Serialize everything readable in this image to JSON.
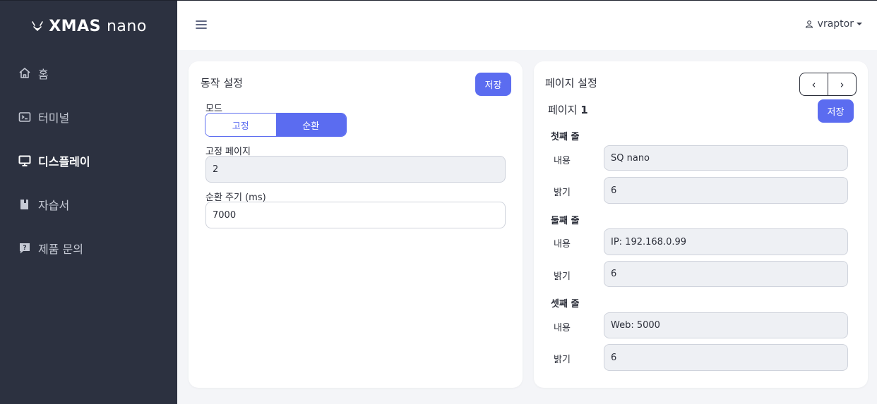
{
  "brand": {
    "strong": "XMAS",
    "light": "nano"
  },
  "sidebar": {
    "items": [
      {
        "label": "홈",
        "icon": "home-icon",
        "active": false
      },
      {
        "label": "터미널",
        "icon": "terminal-icon",
        "active": false
      },
      {
        "label": "디스플레이",
        "icon": "monitor-icon",
        "active": true
      },
      {
        "label": "자습서",
        "icon": "book-icon",
        "active": false
      },
      {
        "label": "제품 문의",
        "icon": "question-chat-icon",
        "active": false
      }
    ]
  },
  "topbar": {
    "user": "vraptor"
  },
  "operation": {
    "title": "동작 설정",
    "save_label": "저장",
    "mode_label": "모드",
    "mode_options": [
      "고정",
      "순환"
    ],
    "mode_selected": "순환",
    "fixed_page_label": "고정 페이지",
    "fixed_page_value": "2",
    "cycle_label": "순환 주기 (ms)",
    "cycle_value": "7000"
  },
  "page_settings": {
    "title": "페이지 설정",
    "prev_label": "‹",
    "next_label": "›",
    "page_prefix": "페이지",
    "page_number": "1",
    "save_label": "저장",
    "content_label": "내용",
    "brightness_label": "밝기",
    "lines": [
      {
        "title": "첫째 줄",
        "content": "SQ nano",
        "brightness": "6"
      },
      {
        "title": "둘째 줄",
        "content": "IP: 192.168.0.99",
        "brightness": "6"
      },
      {
        "title": "셋째 줄",
        "content": "Web: 5000",
        "brightness": "6"
      }
    ]
  },
  "colors": {
    "sidebar_bg": "#2c3140",
    "accent": "#5b6cf0",
    "page_bg": "#f4f5f8"
  }
}
